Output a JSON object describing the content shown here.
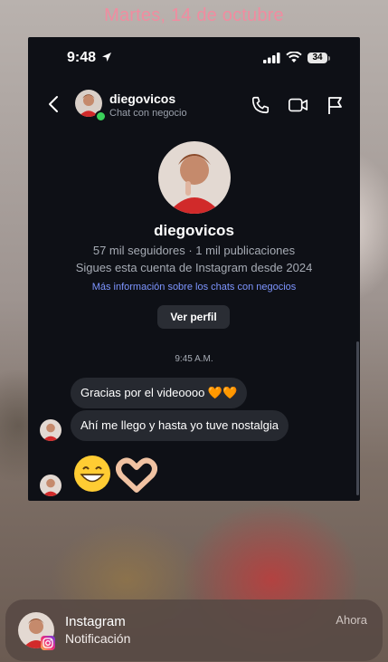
{
  "lock_screen": {
    "date": "Martes, 14 de octubre"
  },
  "status_bar": {
    "time": "9:48",
    "battery": "34"
  },
  "chat_header": {
    "username": "diegovicos",
    "subtitle": "Chat con negocio"
  },
  "profile": {
    "username": "diegovicos",
    "stats": "57 mil seguidores · 1 mil publicaciones",
    "follow_since": "Sigues esta cuenta de Instagram desde 2024",
    "business_link": "Más información sobre los chats con negocios",
    "view_profile_button": "Ver perfil"
  },
  "messages": {
    "timestamp": "9:45 A.M.",
    "items": [
      {
        "text": "Gracias por el videoooo 🧡🧡"
      },
      {
        "text": "Ahí me llego y hasta yo tuve nostalgia"
      },
      {
        "text": "😁🫶🏻"
      }
    ]
  },
  "notification": {
    "app": "Instagram",
    "body": "Notificación",
    "time": "Ahora"
  },
  "colors": {
    "date": "#f08ca0",
    "link": "#7d95ff",
    "bubble": "#262930",
    "online": "#3ad15a"
  }
}
